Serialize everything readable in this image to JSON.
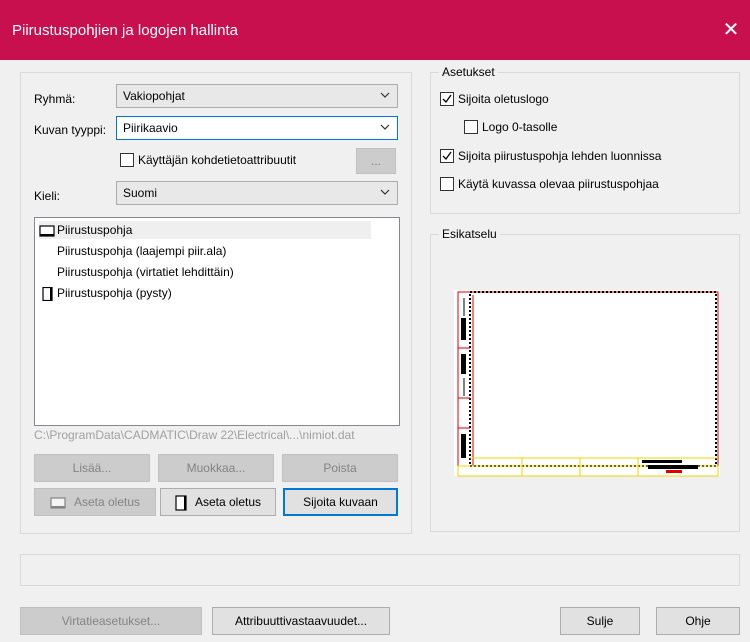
{
  "window": {
    "title": "Piirustuspohjien ja logojen hallinta",
    "close_glyph": "✕"
  },
  "form": {
    "group_label": "Ryhmä:",
    "group_value": "Vakiopohjat",
    "type_label": "Kuvan tyyppi:",
    "type_value": "Piirikaavio",
    "user_attr_label": "Käyttäjän kohdetietoattribuutit",
    "user_attr_checked": false,
    "ellipsis_label": "...",
    "lang_label": "Kieli:",
    "lang_value": "Suomi"
  },
  "templates": {
    "items": [
      {
        "label": "Piirustuspohja",
        "icon": "landscape-page-icon",
        "selected": true
      },
      {
        "label": "Piirustuspohja (laajempi piir.ala)",
        "icon": "",
        "selected": false
      },
      {
        "label": "Piirustuspohja (virtatiet lehdittäin)",
        "icon": "",
        "selected": false
      },
      {
        "label": "Piirustuspohja (pysty)",
        "icon": "portrait-page-icon",
        "selected": false
      }
    ],
    "path": "C:\\ProgramData\\CADMATIC\\Draw 22\\Electrical\\...\\nimiot.dat"
  },
  "buttons": {
    "add": "Lisää...",
    "edit": "Muokkaa...",
    "delete": "Poista",
    "set_default_landscape": "Aseta oletus",
    "set_default_portrait": "Aseta oletus",
    "place_in_drawing": "Sijoita kuvaan",
    "circuit_settings": "Virtatieasetukset...",
    "attribute_mapping": "Attribuuttivastaavuudet...",
    "close": "Sulje",
    "help": "Ohje"
  },
  "settings": {
    "legend": "Asetukset",
    "place_default_logo": {
      "label": "Sijoita oletuslogo",
      "checked": true
    },
    "logo_level0": {
      "label": "Logo 0-tasolle",
      "checked": false
    },
    "place_template_on_sheet": {
      "label": "Sijoita piirustuspohja lehden luonnissa",
      "checked": true
    },
    "use_template_in_drawing": {
      "label": "Käytä kuvassa olevaa piirustuspohjaa",
      "checked": false
    }
  },
  "preview": {
    "legend": "Esikatselu"
  },
  "colors": {
    "titlebar": "#c8104f",
    "dialog_bg": "#f0f0f0",
    "focus": "#0078d7",
    "preview_red": "#e00000",
    "preview_yellow": "#e8d800"
  }
}
